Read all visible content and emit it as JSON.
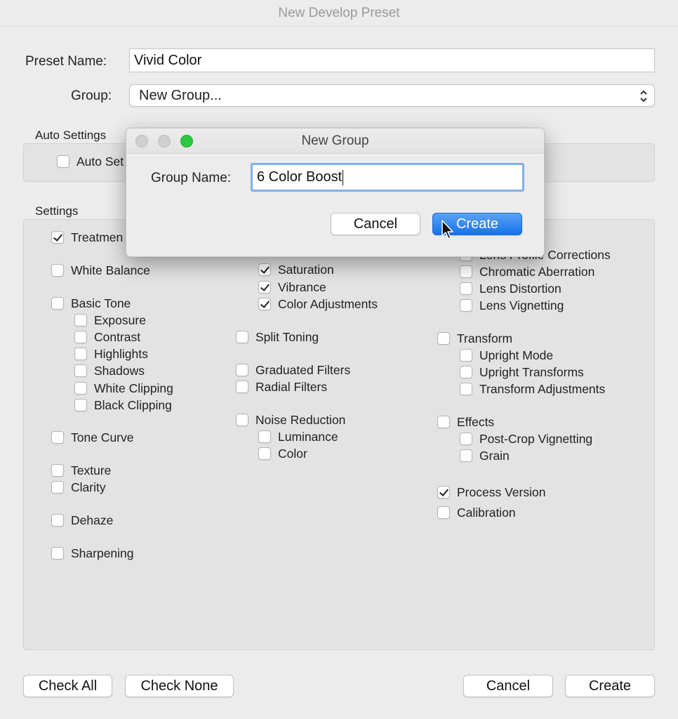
{
  "window": {
    "title": "New Develop Preset"
  },
  "preset": {
    "name_label": "Preset Name:",
    "name_value": "Vivid Color",
    "group_label": "Group:",
    "group_value": "New Group..."
  },
  "auto_settings": {
    "title": "Auto Settings",
    "checkbox": {
      "label": "Auto Settings",
      "visible_label": "Auto Set",
      "checked": false
    }
  },
  "settings": {
    "title": "Settings",
    "col1": [
      {
        "label": "Treatment",
        "visible": "Treatmen",
        "checked": true,
        "indent": false
      },
      {
        "label": "White Balance",
        "checked": false,
        "indent": false
      },
      {
        "label": "Basic Tone",
        "checked": false,
        "indent": false
      },
      {
        "label": "Exposure",
        "checked": false,
        "indent": true
      },
      {
        "label": "Contrast",
        "checked": false,
        "indent": true
      },
      {
        "label": "Highlights",
        "checked": false,
        "indent": true
      },
      {
        "label": "Shadows",
        "checked": false,
        "indent": true
      },
      {
        "label": "White Clipping",
        "checked": false,
        "indent": true
      },
      {
        "label": "Black Clipping",
        "checked": false,
        "indent": true
      },
      {
        "label": "Tone Curve",
        "checked": false,
        "indent": false
      },
      {
        "label": "Texture",
        "checked": false,
        "indent": false
      },
      {
        "label": "Clarity",
        "checked": false,
        "indent": false
      },
      {
        "label": "Dehaze",
        "checked": false,
        "indent": false
      },
      {
        "label": "Sharpening",
        "checked": false,
        "indent": false
      }
    ],
    "col2": [
      {
        "label": "Saturation",
        "checked": true,
        "indent": true
      },
      {
        "label": "Vibrance",
        "checked": true,
        "indent": true
      },
      {
        "label": "Color Adjustments",
        "checked": true,
        "indent": true
      },
      {
        "label": "Split Toning",
        "checked": false,
        "indent": false
      },
      {
        "label": "Graduated Filters",
        "checked": false,
        "indent": false
      },
      {
        "label": "Radial Filters",
        "checked": false,
        "indent": false
      },
      {
        "label": "Noise Reduction",
        "checked": false,
        "indent": false
      },
      {
        "label": "Luminance",
        "checked": false,
        "indent": true
      },
      {
        "label": "Color",
        "checked": false,
        "indent": true
      }
    ],
    "col3": [
      {
        "label": "Lens Profile Corrections",
        "checked": false,
        "indent": true
      },
      {
        "label": "Chromatic Aberration",
        "checked": false,
        "indent": true
      },
      {
        "label": "Lens Distortion",
        "checked": false,
        "indent": true
      },
      {
        "label": "Lens Vignetting",
        "checked": false,
        "indent": true
      },
      {
        "label": "Transform",
        "checked": false,
        "indent": false
      },
      {
        "label": "Upright Mode",
        "checked": false,
        "indent": true
      },
      {
        "label": "Upright Transforms",
        "checked": false,
        "indent": true
      },
      {
        "label": "Transform Adjustments",
        "checked": false,
        "indent": true
      },
      {
        "label": "Effects",
        "checked": false,
        "indent": false
      },
      {
        "label": "Post-Crop Vignetting",
        "checked": false,
        "indent": true
      },
      {
        "label": "Grain",
        "checked": false,
        "indent": true
      },
      {
        "label": "Process Version",
        "checked": true,
        "indent": false
      },
      {
        "label": "Calibration",
        "checked": false,
        "indent": false
      }
    ]
  },
  "footer": {
    "check_all": "Check All",
    "check_none": "Check None",
    "cancel": "Cancel",
    "create": "Create"
  },
  "modal": {
    "title": "New Group",
    "field_label": "Group Name:",
    "field_value": "6 Color Boost",
    "cancel": "Cancel",
    "create": "Create"
  },
  "icons": {
    "checkmark": "checkmark-icon",
    "select_chevron": "up-down-chevron-icon",
    "cursor": "mouse-pointer-icon"
  },
  "colors": {
    "accent": "#1573ea",
    "focus_ring": "#7fb0ec",
    "traffic_light_green": "#2bc840"
  }
}
